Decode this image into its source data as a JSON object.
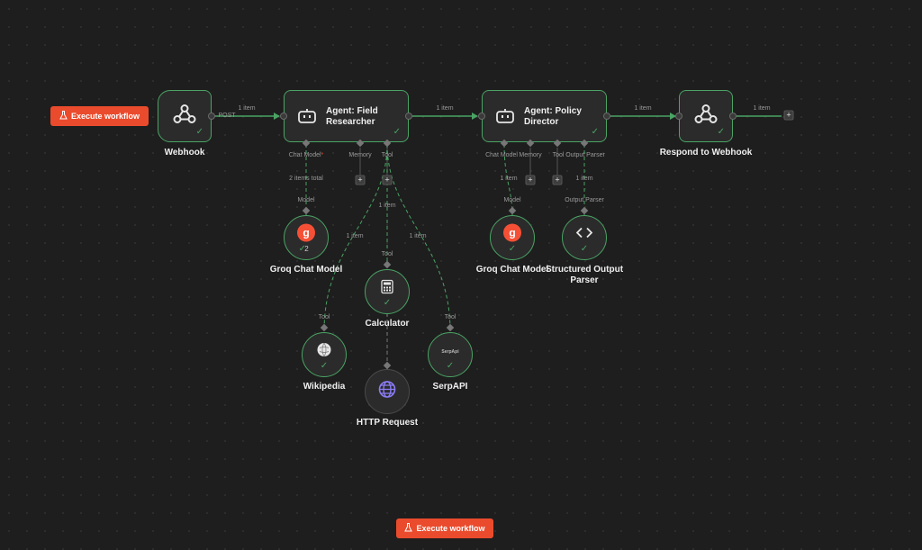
{
  "toolbar": {
    "execute_label": "Execute workflow",
    "execute_label_bottom": "Execute workflow",
    "flask_icon": "flask-icon"
  },
  "colors": {
    "accent": "#ea4b2d",
    "success": "#4aa364",
    "canvas": "#1e1e1e",
    "node_bg": "#2b2b2b",
    "http_icon": "#8b7cf6",
    "groq": "#f55036"
  },
  "nodes": {
    "webhook": {
      "label": "Webhook",
      "icon": "webhook-icon",
      "port_label": "POST"
    },
    "field_researcher": {
      "title_line1": "Agent: Field",
      "title_line2": "Researcher",
      "icon": "robot-icon"
    },
    "policy_director": {
      "title_line1": "Agent: Policy",
      "title_line2": "Director",
      "icon": "robot-icon"
    },
    "respond_webhook": {
      "label": "Respond to Webhook",
      "icon": "webhook-icon"
    },
    "groq_1": {
      "label": "Groq Chat Model",
      "icon": "groq-icon",
      "count": "2"
    },
    "calculator": {
      "label": "Calculator",
      "icon": "calculator-icon"
    },
    "wikipedia": {
      "label": "Wikipedia",
      "icon": "wikipedia-icon"
    },
    "serpapi": {
      "label": "SerpAPI",
      "icon": "serpapi-icon",
      "icon_text": "SerpApi"
    },
    "http_request": {
      "label": "HTTP Request",
      "icon": "globe-icon"
    },
    "groq_2": {
      "label": "Groq Chat Model",
      "icon": "groq-icon"
    },
    "structured_parser": {
      "label_line1": "Structured Output",
      "label_line2": "Parser",
      "icon": "code-brackets-icon"
    }
  },
  "ports": {
    "fr_chat_model": "Chat Model",
    "fr_memory": "Memory",
    "fr_tool": "Tool",
    "pd_chat_model": "Chat Model",
    "pd_memory": "Memory",
    "pd_tool": "Tool",
    "pd_output_parser": "Output Parser"
  },
  "edge_labels": {
    "webhook_to_fr": "1 item",
    "fr_to_pd": "1 item",
    "pd_to_respond": "1 item",
    "respond_out": "1 item",
    "fr_chat_items": "2 items total",
    "fr_chat_target": "Model",
    "fr_tool_calc": "1 item",
    "fr_tool_calc_target": "Tool",
    "fr_tool_wiki": "1 item",
    "fr_tool_wiki_target": "Tool",
    "fr_tool_serp": "1 item",
    "fr_tool_serp_target": "Tool",
    "pd_chat_items": "1 item",
    "pd_chat_target": "Model",
    "pd_parser_items": "1 item",
    "pd_parser_target": "Output Parser"
  }
}
